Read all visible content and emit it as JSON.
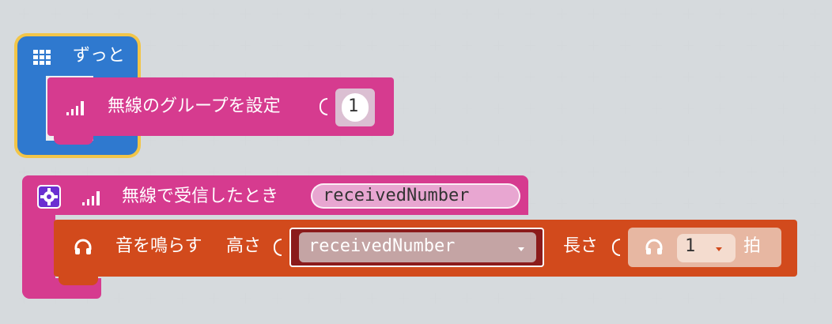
{
  "blocks": {
    "forever": {
      "label": "ずっと",
      "icon": "grid-icon",
      "color": "#2f79cf",
      "highlight": "#f2c548",
      "set_group": {
        "label": "無線のグループを設定",
        "icon": "signal-bars-icon",
        "color": "#d63b8f",
        "value": "1"
      }
    },
    "on_received": {
      "label": "無線で受信したとき",
      "icon": "signal-bars-icon",
      "gear_icon": "gear-icon",
      "variable": "receivedNumber",
      "color": "#d63b8f",
      "play_tone": {
        "label": "音を鳴らす",
        "pitch_label": "高さ",
        "pitch_variable": "receivedNumber",
        "duration_label": "長さ",
        "beat_value": "1",
        "beat_unit": "拍",
        "icon": "headphones-icon",
        "color": "#d24a1c"
      }
    }
  }
}
